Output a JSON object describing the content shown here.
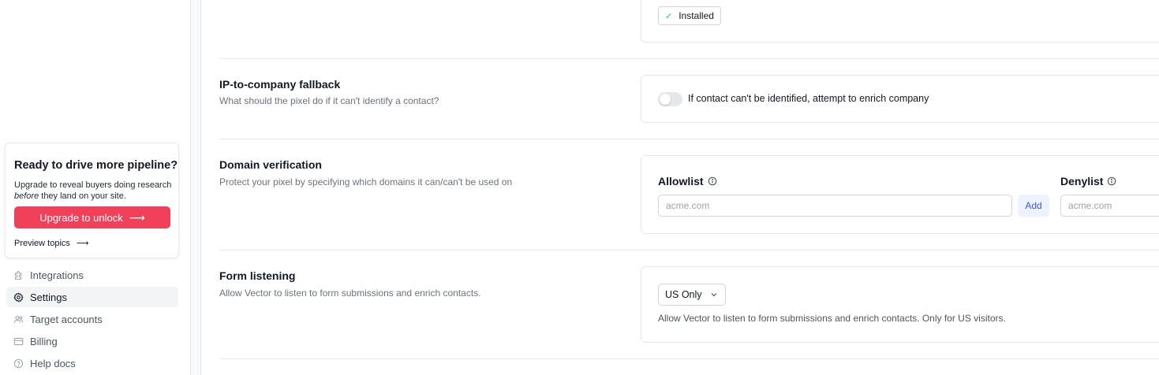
{
  "promo": {
    "title": "Ready to drive more pipeline?",
    "desc_before": "Upgrade to reveal buyers doing research ",
    "desc_em": "before",
    "desc_after": " they land on your site.",
    "button_label": "Upgrade to unlock",
    "preview_label": "Preview topics"
  },
  "nav": {
    "items": [
      {
        "label": "Integrations",
        "icon": "puzzle-icon"
      },
      {
        "label": "Settings",
        "icon": "gear-icon"
      },
      {
        "label": "Target accounts",
        "icon": "users-icon"
      },
      {
        "label": "Billing",
        "icon": "credit-card-icon"
      },
      {
        "label": "Help docs",
        "icon": "help-circle-icon"
      }
    ],
    "active": "Settings"
  },
  "install": {
    "badge_label": "Installed"
  },
  "fallback": {
    "title": "IP-to-company fallback",
    "subtitle": "What should the pixel do if it can't identify a contact?",
    "toggle_label": "If contact can't be identified, attempt to enrich company",
    "toggle_on": false
  },
  "domain": {
    "title": "Domain verification",
    "subtitle": "Protect your pixel by specifying which domains it can/can't be used on",
    "allowlist_label": "Allowlist",
    "allowlist_placeholder": "acme.com",
    "add_label": "Add",
    "denylist_label": "Denylist",
    "denylist_placeholder": "acme.com"
  },
  "form": {
    "title": "Form listening",
    "subtitle": "Allow Vector to listen to form submissions and enrich contacts.",
    "select_value": "US Only",
    "help_text": "Allow Vector to listen to form submissions and enrich contacts. Only for US visitors."
  },
  "colors": {
    "accent": "#f0405a",
    "success": "#22c55e",
    "link": "#3b5bdb"
  }
}
